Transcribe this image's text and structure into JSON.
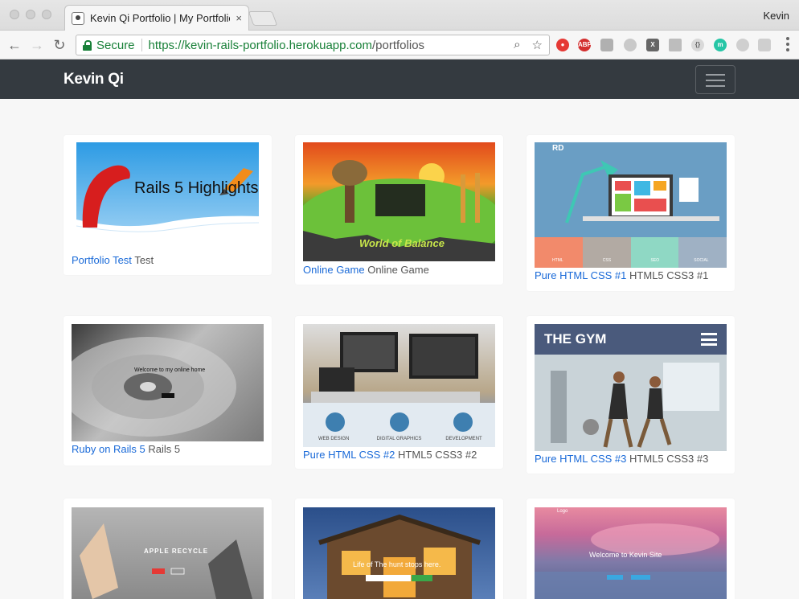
{
  "browser": {
    "tab_title": "Kevin Qi Portfolio | My Portfolio",
    "tab_close": "×",
    "profile_name": "Kevin",
    "secure_label": "Secure",
    "url_base": "https://kevin-rails-portfolio.herokuapp.com",
    "url_path": "/portfolios",
    "extensions": [
      "ABP"
    ]
  },
  "site": {
    "brand": "Kevin Qi"
  },
  "portfolios": [
    {
      "title": "Portfolio Test",
      "subtitle": "Test",
      "thumb_text": "Rails 5 Highlights"
    },
    {
      "title": "Online Game",
      "subtitle": "Online Game",
      "thumb_text": "World of Balance"
    },
    {
      "title": "Pure HTML CSS #1",
      "subtitle": "HTML5 CSS3 #1",
      "thumb_text": "RD",
      "thumb_tabs": [
        "HTML",
        "CSS",
        "SEO",
        "SOCIAL"
      ]
    },
    {
      "title": "Ruby on Rails 5",
      "subtitle": "Rails 5",
      "thumb_text": "Welcome to my online home"
    },
    {
      "title": "Pure HTML CSS #2",
      "subtitle": "HTML5 CSS3 #2",
      "thumb_tabs": [
        "WEB DESIGN",
        "DIGITAL GRAPHICS",
        "DEVELOPMENT"
      ]
    },
    {
      "title": "Pure HTML CSS #3",
      "subtitle": "HTML5 CSS3 #3",
      "thumb_text": "THE GYM"
    },
    {
      "title": "",
      "subtitle": "",
      "thumb_text": "APPLE RECYCLE"
    },
    {
      "title": "",
      "subtitle": "",
      "thumb_text": "Life of The hunt stops here."
    },
    {
      "title": "",
      "subtitle": "",
      "thumb_text": "Welcome to Kevin Site",
      "thumb_logo": "Logo"
    }
  ],
  "colors": {
    "navbar": "#343a40",
    "link": "#1a6ad8",
    "secure_green": "#188038"
  }
}
